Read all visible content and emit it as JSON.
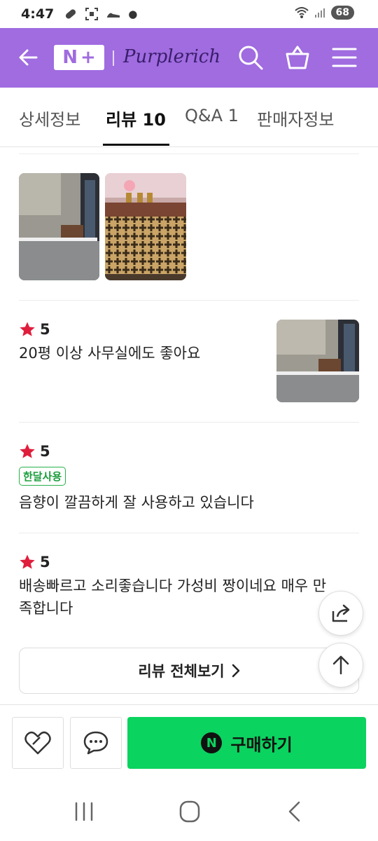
{
  "status_bar": {
    "time": "4:47",
    "battery": "68"
  },
  "header": {
    "nplus_n": "N",
    "nplus_plus": "+",
    "brand": "Purplerich",
    "accent_color": "#a06ce0"
  },
  "tabs": [
    {
      "label": "상세정보",
      "active": false
    },
    {
      "label": "리뷰 10",
      "active": true
    },
    {
      "label": "Q&A 1",
      "active": false
    },
    {
      "label": "판매자정보",
      "active": false
    }
  ],
  "reviews": [
    {
      "rating": "5",
      "text": "20평 이상 사무실에도 좋아요",
      "has_photo": true
    },
    {
      "rating": "5",
      "badge": "한달사용",
      "text": "음향이 깔끔하게 잘 사용하고 있습니다"
    },
    {
      "rating": "5",
      "text_line1": "배송빠르고 소리좋습니다 가성비 짱이네요 매우 만",
      "text_line2": "족합니다"
    }
  ],
  "all_reviews_label": "리뷰 전체보기",
  "bottom_bar": {
    "buy_label": "구매하기",
    "buy_badge": "N",
    "buy_color": "#0bd35f"
  },
  "icons": [
    "back-arrow-icon",
    "search-icon",
    "shopping-bag-icon",
    "hamburger-menu-icon",
    "star-icon",
    "share-icon",
    "arrow-up-icon",
    "heart-icon",
    "chat-bubble-icon",
    "recent-apps-icon",
    "home-icon",
    "back-icon"
  ]
}
